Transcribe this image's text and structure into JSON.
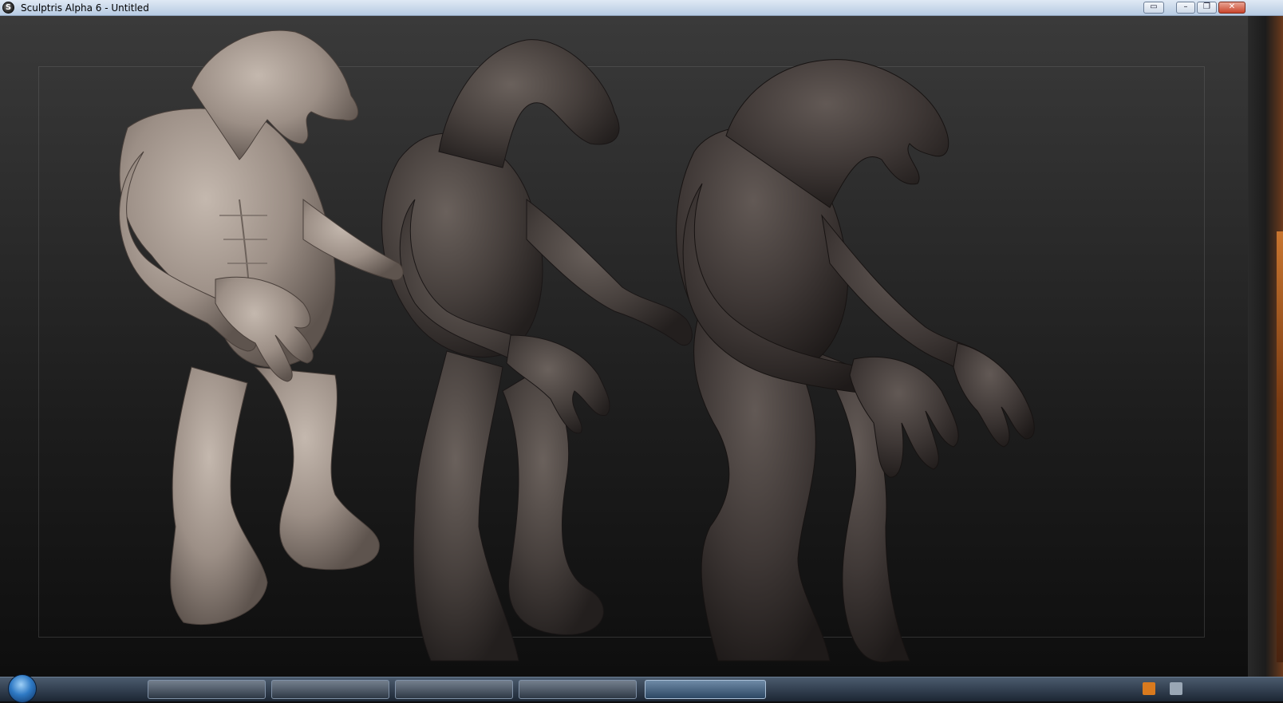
{
  "window": {
    "title": "Sculptris Alpha 6 - Untitled",
    "app_icon_glyph": "S",
    "controls": {
      "extra_glyph": "▭",
      "minimize_glyph": "–",
      "restore_glyph": "❐",
      "close_glyph": "✕"
    }
  },
  "viewport": {
    "background_top": "#3a3a3a",
    "background_bottom": "#0e0e0e",
    "models": [
      {
        "name": "creature-detailed",
        "material_color": "#9c8f86"
      },
      {
        "name": "creature-smooth-middle",
        "material_color": "#463f3c"
      },
      {
        "name": "creature-smooth-front",
        "material_color": "#3f3836"
      }
    ]
  },
  "taskbar": {
    "items": [
      "",
      "",
      "",
      "",
      ""
    ],
    "active_index": 4,
    "tray_icons": [
      "flag-icon",
      "network-icon"
    ]
  }
}
